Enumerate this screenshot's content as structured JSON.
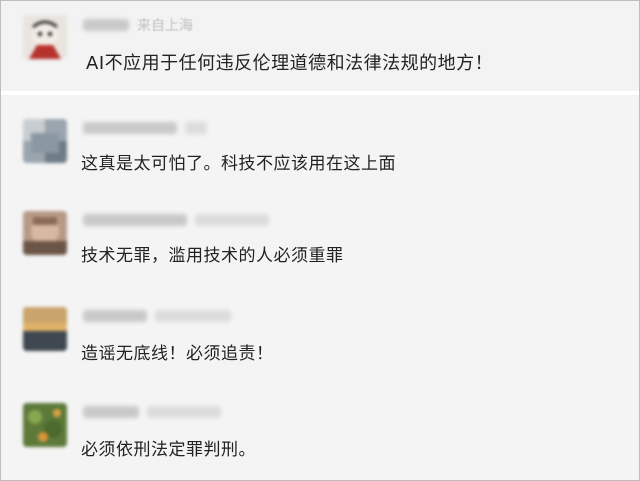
{
  "featured": {
    "username": "",
    "location": "来自上海",
    "text": "AI不应用于任何违反伦理道德和法律法规的地方！"
  },
  "comments": [
    {
      "text": "这真是太可怕了。科技不应该用在这上面"
    },
    {
      "text": "技术无罪，滥用技术的人必须重罪"
    },
    {
      "text": "造谣无底线！必须追责！"
    },
    {
      "text": "必须依刑法定罪判刑。"
    }
  ],
  "colors": {
    "panel_bg": "#f4f4f4",
    "text": "#222222",
    "meta_text": "#b8b8b8"
  }
}
